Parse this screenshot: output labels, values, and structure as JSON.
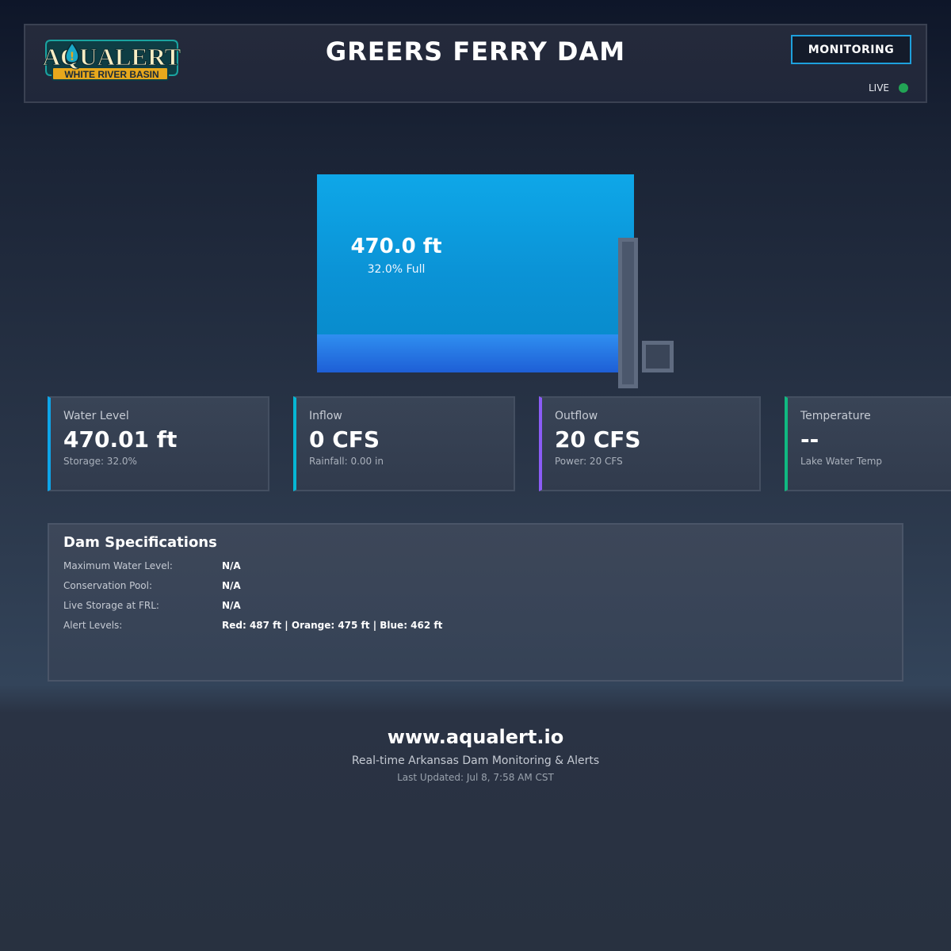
{
  "header": {
    "logo_text": "AQUALERT",
    "logo_subtitle": "WHITE RIVER BASIN",
    "title": "GREERS FERRY DAM",
    "status_button": "MONITORING",
    "live_label": "LIVE",
    "live_color": "#22a455"
  },
  "reservoir": {
    "level_label": "470.0 ft",
    "percent_label": "32.0% Full",
    "percent_full": 32.0,
    "surface_color": "#0ea7e8",
    "fill_color": "#2f8ff0"
  },
  "cards": [
    {
      "label": "Water Level",
      "value": "470.01 ft",
      "sub": "Storage: 32.0%",
      "accent": "#0ea5e9"
    },
    {
      "label": "Inflow",
      "value": "0 CFS",
      "sub": "Rainfall: 0.00 in",
      "accent": "#06b6d4"
    },
    {
      "label": "Outflow",
      "value": "20 CFS",
      "sub": "Power: 20 CFS",
      "accent": "#8b5cf6"
    },
    {
      "label": "Temperature",
      "value": "--",
      "sub": "Lake Water Temp",
      "accent": "#10b981"
    }
  ],
  "specs": {
    "title": "Dam Specifications",
    "rows": [
      {
        "label": "Maximum Water Level:",
        "value": "N/A"
      },
      {
        "label": "Conservation Pool:",
        "value": "N/A"
      },
      {
        "label": "Live Storage at FRL:",
        "value": "N/A"
      },
      {
        "label": "Alert Levels:",
        "value": "Red: 487 ft | Orange: 475 ft | Blue: 462 ft"
      }
    ]
  },
  "footer": {
    "url": "www.aqualert.io",
    "tagline": "Real-time Arkansas Dam Monitoring & Alerts",
    "updated": "Last Updated: Jul 8, 7:58 AM CST"
  }
}
